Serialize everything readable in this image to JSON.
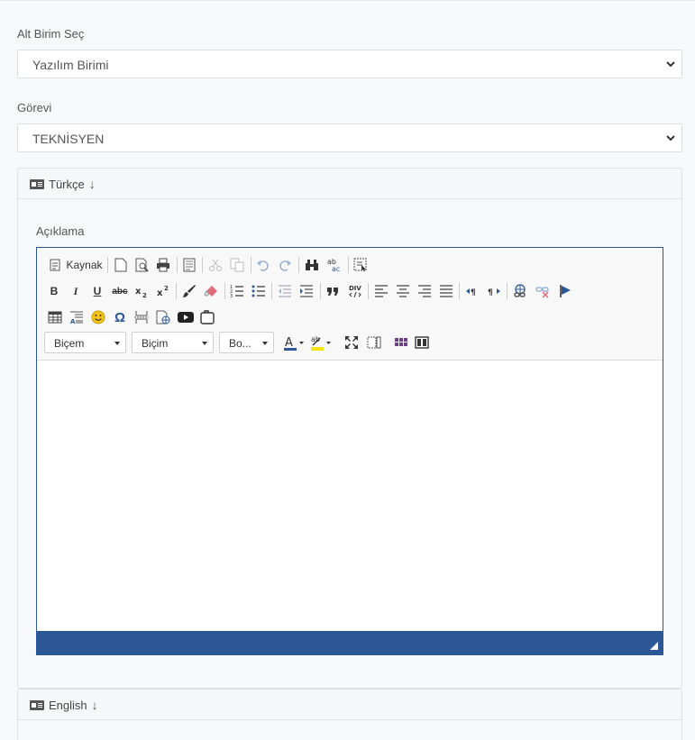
{
  "form": {
    "alt_birim_label": "Alt Birim Seç",
    "alt_birim_value": "Yazılım Birimi",
    "gorevi_label": "Görevi",
    "gorevi_value": "TEKNİSYEN"
  },
  "panels": {
    "turkce": {
      "title": "Türkçe",
      "arrow": "↓",
      "field_label": "Açıklama"
    },
    "english": {
      "title": "English",
      "arrow": "↓"
    }
  },
  "editor": {
    "source_label": "Kaynak",
    "format_combo": "Biçem",
    "style_combo": "Biçim",
    "size_combo": "Bo...",
    "bold": "B",
    "italic": "I",
    "underline": "U",
    "strike": "abc",
    "omega": "Ω",
    "accent_color": "#2b5797"
  }
}
